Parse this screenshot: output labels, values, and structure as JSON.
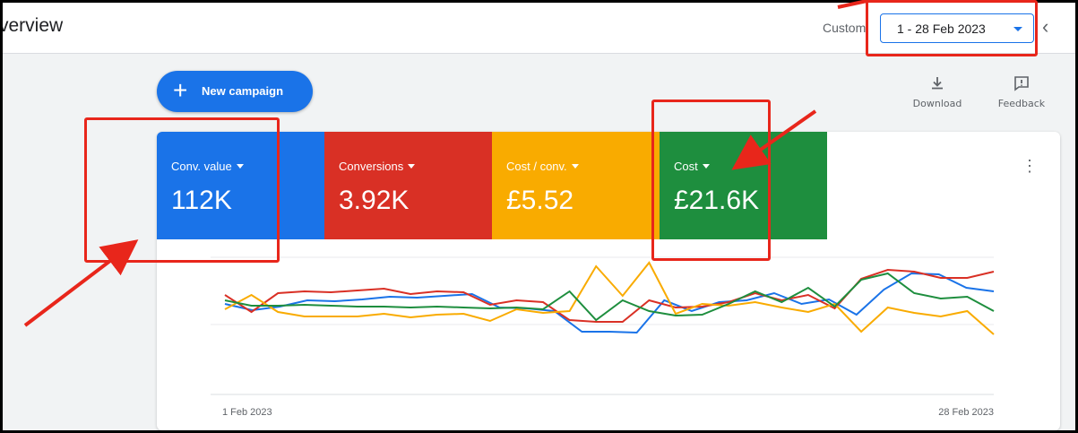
{
  "header": {
    "title": "verview",
    "date_label": "Custom",
    "date_range": "1 - 28 Feb 2023"
  },
  "toolbar": {
    "new_campaign_label": "New campaign",
    "download_label": "Download",
    "feedback_label": "Feedback"
  },
  "metrics": [
    {
      "label": "Conv. value",
      "value": "112K",
      "color": "#1a73e8"
    },
    {
      "label": "Conversions",
      "value": "3.92K",
      "color": "#d93025"
    },
    {
      "label": "Cost / conv.",
      "value": "£5.52",
      "color": "#f9ab00"
    },
    {
      "label": "Cost",
      "value": "£21.6K",
      "color": "#1e8e3e"
    }
  ],
  "chart_data": {
    "type": "line",
    "x_start_label": "1 Feb 2023",
    "x_end_label": "28 Feb 2023",
    "series": [
      {
        "color": "#1a73e8",
        "values": [
          48,
          41,
          45,
          52,
          51,
          53,
          56,
          55,
          57,
          59,
          44,
          43,
          40,
          17,
          17,
          16,
          52,
          40,
          50,
          52,
          60,
          48,
          53,
          36,
          64,
          82,
          81,
          66,
          62
        ]
      },
      {
        "color": "#d93025",
        "values": [
          58,
          39,
          60,
          62,
          61,
          63,
          65,
          59,
          62,
          61,
          47,
          52,
          50,
          30,
          28,
          28,
          52,
          44,
          45,
          50,
          60,
          52,
          58,
          43,
          76,
          86,
          84,
          77,
          77,
          84
        ]
      },
      {
        "color": "#f9ab00",
        "values": [
          42,
          58,
          39,
          34,
          34,
          34,
          37,
          33,
          36,
          37,
          29,
          42,
          38,
          40,
          90,
          57,
          94,
          37,
          48,
          46,
          50,
          44,
          39,
          48,
          17,
          44,
          38,
          34,
          40,
          14
        ]
      },
      {
        "color": "#1e8e3e",
        "values": [
          52,
          46,
          46,
          47,
          46,
          45,
          45,
          44,
          45,
          44,
          43,
          44,
          42,
          62,
          30,
          52,
          40,
          35,
          36,
          48,
          62,
          50,
          66,
          45,
          75,
          82,
          60,
          54,
          56,
          40
        ]
      }
    ]
  }
}
